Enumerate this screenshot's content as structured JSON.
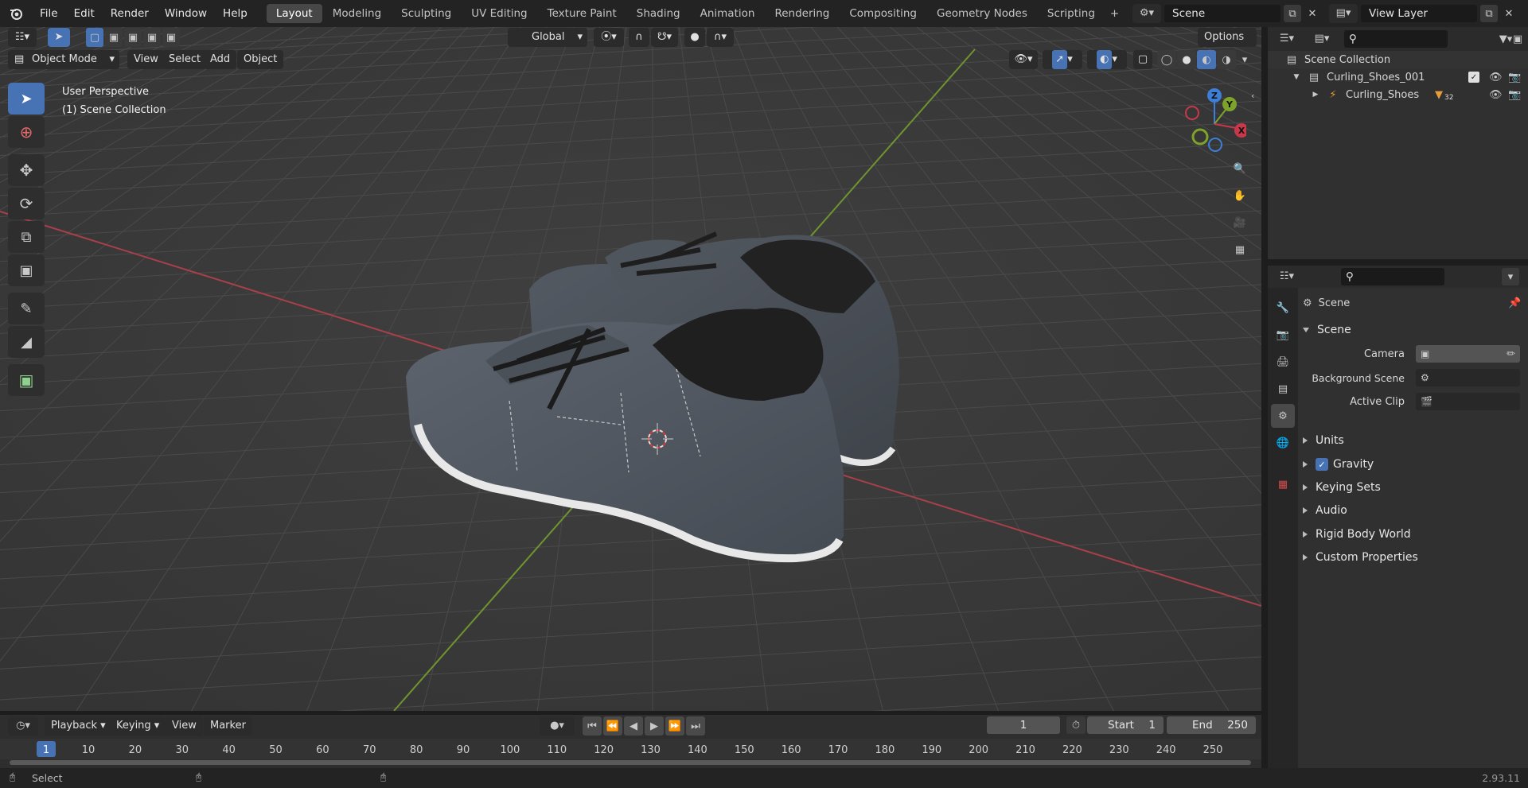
{
  "topbar": {
    "menus": [
      "File",
      "Edit",
      "Render",
      "Window",
      "Help"
    ],
    "workspaces": [
      "Layout",
      "Modeling",
      "Sculpting",
      "UV Editing",
      "Texture Paint",
      "Shading",
      "Animation",
      "Rendering",
      "Compositing",
      "Geometry Nodes",
      "Scripting"
    ],
    "active_workspace": "Layout",
    "add_tab": "+",
    "scene_name": "Scene",
    "view_layer": "View Layer"
  },
  "viewport_header": {
    "transform_orientation": "Global",
    "options_label": "Options",
    "mode": "Object Mode",
    "menus": [
      "View",
      "Select",
      "Add",
      "Object"
    ]
  },
  "viewport": {
    "perspective_label": "User Perspective",
    "collection_label": "(1) Scene Collection",
    "gizmo_axes": {
      "x": "X",
      "y": "Y",
      "z": "Z"
    },
    "object": "Curling_Shoes"
  },
  "outliner": {
    "root": "Scene Collection",
    "collection": "Curling_Shoes_001",
    "object": "Curling_Shoes",
    "modifier_count": "32"
  },
  "properties": {
    "breadcrumb": "Scene",
    "panel_title": "Scene",
    "fields": [
      {
        "label": "Camera",
        "value": ""
      },
      {
        "label": "Background Scene",
        "value": ""
      },
      {
        "label": "Active Clip",
        "value": ""
      }
    ],
    "subpanels": [
      "Units",
      "Gravity",
      "Keying Sets",
      "Audio",
      "Rigid Body World",
      "Custom Properties"
    ],
    "gravity_checked": true
  },
  "timeline": {
    "menus": [
      "Playback",
      "Keying",
      "View",
      "Marker"
    ],
    "current_frame": "1",
    "start_label": "Start",
    "start_value": "1",
    "end_label": "End",
    "end_value": "250",
    "ticks": [
      "1",
      "10",
      "20",
      "30",
      "40",
      "50",
      "60",
      "70",
      "80",
      "90",
      "100",
      "110",
      "120",
      "130",
      "140",
      "150",
      "160",
      "170",
      "180",
      "190",
      "200",
      "210",
      "220",
      "230",
      "240",
      "250"
    ]
  },
  "statusbar": {
    "left_hint": "Select",
    "version": "2.93.11"
  },
  "colors": {
    "accent": "#4772b3",
    "x_axis": "#c7394a",
    "y_axis": "#7ea32a",
    "z_axis": "#3d7fd6"
  }
}
